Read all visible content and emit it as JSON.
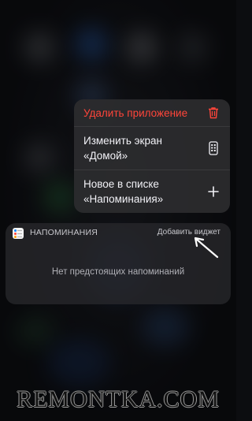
{
  "menu": {
    "items": [
      {
        "label": "Удалить приложение",
        "icon": "trash-icon",
        "destructive": true,
        "color": "#ff453a"
      },
      {
        "label": "Изменить экран\n«Домой»",
        "icon": "phone-screen-icon"
      },
      {
        "label": "Новое в списке\n«Напоминания»",
        "icon": "plus-icon"
      }
    ]
  },
  "widget": {
    "app_name": "НАПОМИНАНИЯ",
    "add_widget_label": "Добавить виджет",
    "empty_text": "Нет предстоящих напоминаний"
  },
  "watermark": "REMONTKA.COM"
}
